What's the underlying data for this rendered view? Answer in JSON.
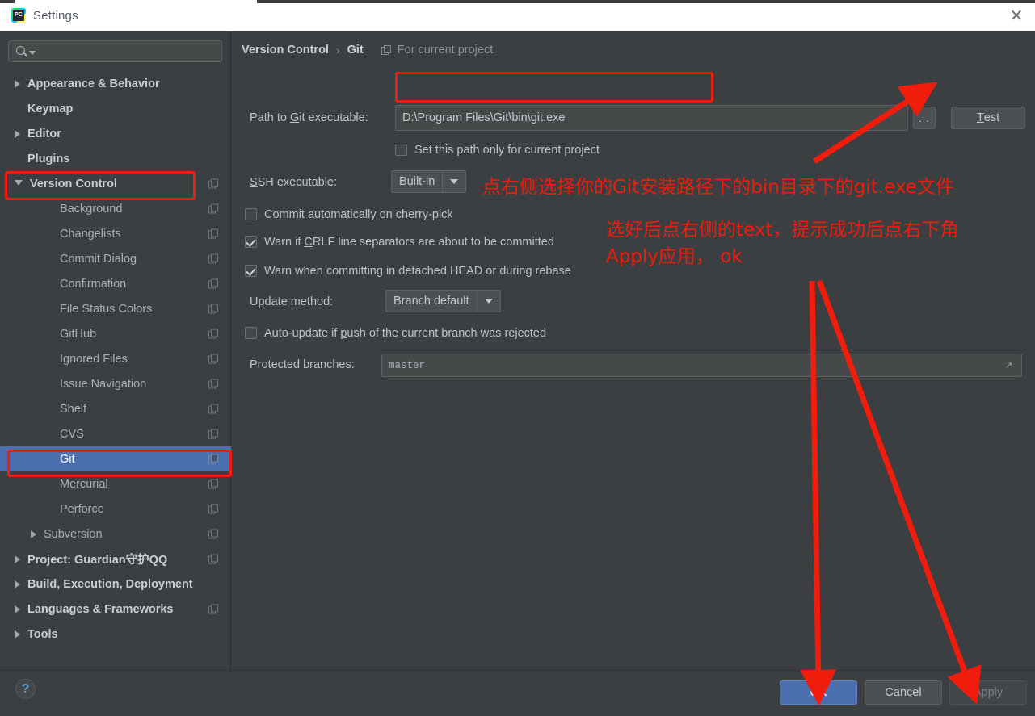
{
  "window": {
    "title": "Settings",
    "app_icon": "pycharm-icon",
    "close_icon": "close-icon"
  },
  "sidebar": {
    "search": {
      "placeholder": "",
      "value": "",
      "icon": "search-icon",
      "caret_icon": "chevron-down-icon"
    },
    "items": [
      {
        "label": "Appearance & Behavior",
        "level": 0,
        "arrow": "right",
        "copy_icon": false,
        "selected": false
      },
      {
        "label": "Keymap",
        "level": 0,
        "arrow": "none",
        "copy_icon": false,
        "selected": false
      },
      {
        "label": "Editor",
        "level": 0,
        "arrow": "right",
        "copy_icon": false,
        "selected": false
      },
      {
        "label": "Plugins",
        "level": 0,
        "arrow": "none",
        "copy_icon": false,
        "selected": false
      },
      {
        "label": "Version Control",
        "level": 0,
        "arrow": "down",
        "copy_icon": true,
        "selected": false,
        "highlighted": true
      },
      {
        "label": "Background",
        "level": 1,
        "arrow": "none",
        "copy_icon": true,
        "selected": false
      },
      {
        "label": "Changelists",
        "level": 1,
        "arrow": "none",
        "copy_icon": true,
        "selected": false
      },
      {
        "label": "Commit Dialog",
        "level": 1,
        "arrow": "none",
        "copy_icon": true,
        "selected": false
      },
      {
        "label": "Confirmation",
        "level": 1,
        "arrow": "none",
        "copy_icon": true,
        "selected": false
      },
      {
        "label": "File Status Colors",
        "level": 1,
        "arrow": "none",
        "copy_icon": true,
        "selected": false
      },
      {
        "label": "GitHub",
        "level": 1,
        "arrow": "none",
        "copy_icon": true,
        "selected": false
      },
      {
        "label": "Ignored Files",
        "level": 1,
        "arrow": "none",
        "copy_icon": true,
        "selected": false
      },
      {
        "label": "Issue Navigation",
        "level": 1,
        "arrow": "none",
        "copy_icon": true,
        "selected": false
      },
      {
        "label": "Shelf",
        "level": 1,
        "arrow": "none",
        "copy_icon": true,
        "selected": false
      },
      {
        "label": "CVS",
        "level": 1,
        "arrow": "none",
        "copy_icon": true,
        "selected": false
      },
      {
        "label": "Git",
        "level": 1,
        "arrow": "none",
        "copy_icon": true,
        "selected": true,
        "highlighted": true
      },
      {
        "label": "Mercurial",
        "level": 1,
        "arrow": "none",
        "copy_icon": true,
        "selected": false
      },
      {
        "label": "Perforce",
        "level": 1,
        "arrow": "none",
        "copy_icon": true,
        "selected": false
      },
      {
        "label": "Subversion",
        "level": 2,
        "arrow": "right",
        "copy_icon": true,
        "selected": false
      },
      {
        "label": "Project: Guardian守护QQ",
        "level": 0,
        "arrow": "right",
        "copy_icon": true,
        "selected": false
      },
      {
        "label": "Build, Execution, Deployment",
        "level": 0,
        "arrow": "right",
        "copy_icon": false,
        "selected": false
      },
      {
        "label": "Languages & Frameworks",
        "level": 0,
        "arrow": "right",
        "copy_icon": true,
        "selected": false
      },
      {
        "label": "Tools",
        "level": 0,
        "arrow": "right",
        "copy_icon": false,
        "selected": false
      }
    ]
  },
  "main": {
    "breadcrumb": {
      "parent": "Version Control",
      "separator": "›",
      "current": "Git",
      "scope_label": "For current project",
      "scope_icon": "project-scope-icon"
    },
    "path_row": {
      "label": "Path to Git executable:",
      "value": "D:\\Program Files\\Git\\bin\\git.exe",
      "browse_label": "...",
      "test_label": "Test"
    },
    "set_path_checkbox": {
      "label": "Set this path only for current project",
      "checked": false
    },
    "ssh_row": {
      "label": "SSH executable:",
      "value": "Built-in"
    },
    "checkboxes": [
      {
        "label": "Commit automatically on cherry-pick",
        "checked": false
      },
      {
        "label": "Warn if CRLF line separators are about to be committed",
        "checked": true
      },
      {
        "label": "Warn when committing in detached HEAD or during rebase",
        "checked": true
      }
    ],
    "update_method": {
      "label": "Update method:",
      "value": "Branch default"
    },
    "autoupdate_checkbox": {
      "label": "Auto-update if push of the current branch was rejected",
      "checked": false
    },
    "protected_branches": {
      "label": "Protected branches:",
      "value": "master",
      "expand_icon": "expand-icon"
    }
  },
  "footer": {
    "help_label": "?",
    "ok_label": "OK",
    "cancel_label": "Cancel",
    "apply_label": "Apply"
  },
  "annotations": {
    "color": "#ee1c0c",
    "texts": [
      "点右侧选择你的Git安装路径下的bin目录下的git.exe文件",
      "选好后点右侧的text，提示成功后点右下角",
      "Apply应用， ok"
    ]
  }
}
